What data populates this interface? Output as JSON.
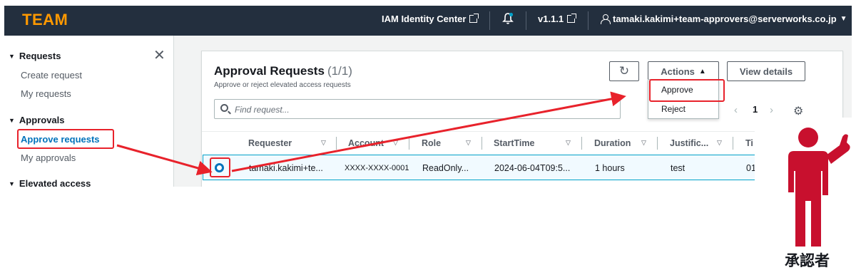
{
  "topnav": {
    "logo": "TEAM",
    "identity_center": "IAM Identity Center",
    "version": "v1.1.1",
    "user": "tamaki.kakimi+team-approvers@serverworks.co.jp",
    "icons": [
      "external-link-icon",
      "bell-icon",
      "user-icon",
      "caret-down-icon"
    ]
  },
  "sidenav": {
    "sections": [
      {
        "label": "Requests",
        "items": [
          "Create request",
          "My requests"
        ]
      },
      {
        "label": "Approvals",
        "items": [
          "Approve requests",
          "My approvals"
        ]
      },
      {
        "label": "Elevated access"
      }
    ],
    "active_item": "Approve requests"
  },
  "panel": {
    "title": "Approval Requests",
    "count": "(1/1)",
    "description": "Approve or reject elevated access requests",
    "refresh_icon": "refresh-icon",
    "actions_label": "Actions",
    "view_details_label": "View details",
    "search_placeholder": "Find request...",
    "dropdown": [
      "Approve",
      "Reject"
    ],
    "page": "1",
    "prev": "‹",
    "next": "›"
  },
  "table": {
    "columns": [
      "Requester",
      "Account",
      "Role",
      "StartTime",
      "Duration",
      "Justific...",
      "Ti"
    ],
    "rows": [
      {
        "requester": "tamaki.kakimi+te...",
        "account": "XXXX-XXXX-0001",
        "role": "ReadOnly...",
        "start_time": "2024-06-04T09:5...",
        "duration": "1 hours",
        "justification": "test",
        "ticket": "01",
        "selected": true
      }
    ]
  },
  "annotation": {
    "person_label": "承認者",
    "highlight_color": "#e8222b",
    "figure_color": "#c8102e"
  }
}
